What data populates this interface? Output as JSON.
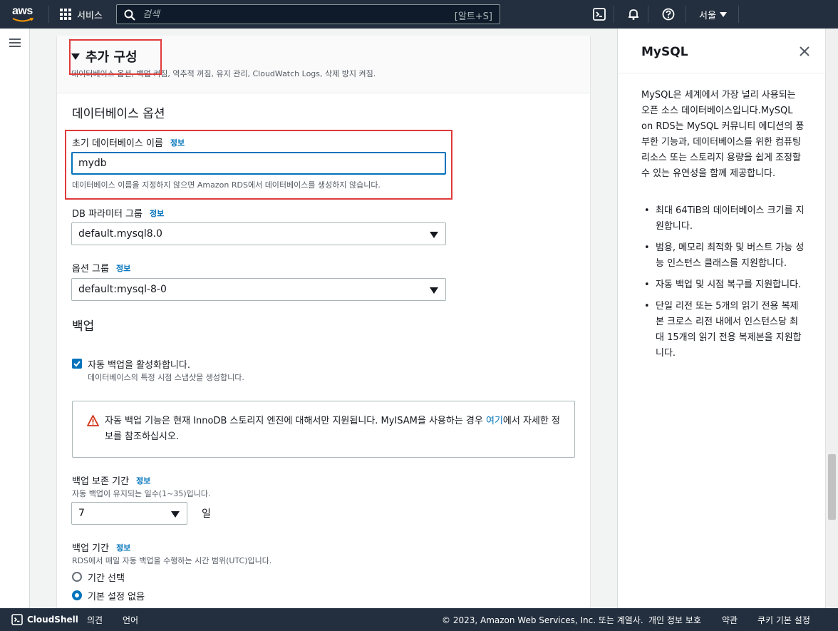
{
  "topnav": {
    "logo": "aws",
    "services_label": "서비스",
    "search_placeholder": "검색",
    "search_shortcut": "[알트+S]",
    "region_label": "서울",
    "icons": [
      "cloudshell-icon",
      "bell-icon",
      "help-icon"
    ]
  },
  "main": {
    "section": {
      "title": "추가 구성",
      "description": "데이터베이스 옵션, 백업 켜짐, 역추적 꺼짐, 유지 관리, CloudWatch Logs, 삭제 방지 켜짐."
    },
    "db_options": {
      "heading": "데이터베이스 옵션",
      "initial_db_name": {
        "label": "초기 데이터베이스 이름",
        "info": "정보",
        "value": "mydb",
        "hint": "데이터베이스 이름을 지정하지 않으면 Amazon RDS에서 데이터베이스를 생성하지 않습니다."
      },
      "db_parameter_group": {
        "label": "DB 파라미터 그룹",
        "info": "정보",
        "value": "default.mysql8.0"
      },
      "option_group": {
        "label": "옵션 그룹",
        "info": "정보",
        "value": "default:mysql-8-0"
      }
    },
    "backup": {
      "heading": "백업",
      "auto_backup": {
        "checked": true,
        "label": "자동 백업을 활성화합니다.",
        "hint": "데이터베이스의 특정 시점 스냅샷을 생성합니다."
      },
      "alert": {
        "text": "자동 백업 기능은 현재 InnoDB 스토리지 엔진에 대해서만 지원됩니다. MyISAM을 사용하는 경우 ",
        "link": "여기",
        "text_after": "에서 자세한 정보를 참조하십시오."
      },
      "retention": {
        "label": "백업 보존 기간",
        "info": "정보",
        "hint": "자동 백업이 유지되는 일수(1~35)입니다.",
        "value": "7",
        "unit": "일"
      },
      "window": {
        "label": "백업 기간",
        "info": "정보",
        "hint": "RDS에서 매일 자동 백업을 수행하는 시간 범위(UTC)입니다.",
        "options": [
          {
            "label": "기간 선택",
            "selected": false
          },
          {
            "label": "기본 설정 없음",
            "selected": true
          }
        ]
      }
    }
  },
  "help_panel": {
    "title": "MySQL",
    "intro": "MySQL은 세계에서 가장 널리 사용되는 오픈 소스 데이터베이스입니다.MySQL on RDS는 MySQL 커뮤니티 에디션의 풍부한 기능과, 데이터베이스를 위한 컴퓨팅 리소스 또는 스토리지 용량을 쉽게 조정할 수 있는 유연성을 함께 제공합니다.",
    "bullets": [
      "최대 64TiB의 데이터베이스 크기를 지원합니다.",
      "범용, 메모리 최적화 및 버스트 가능 성능 인스턴스 클래스를 지원합니다.",
      "자동 백업 및 시점 복구를 지원합니다.",
      "단일 리전 또는 5개의 읽기 전용 복제본 크로스 리전 내에서 인스턴스당 최대 15개의 읽기 전용 복제본을 지원합니다."
    ]
  },
  "footer": {
    "cloudshell": "CloudShell",
    "feedback": "의견",
    "language": "언어",
    "copyright": "© 2023, Amazon Web Services, Inc. 또는 계열사.",
    "privacy": "개인 정보 보호",
    "terms": "약관",
    "cookie": "쿠키 기본 설정"
  },
  "colors": {
    "nav_bg": "#232f3e",
    "link": "#0073bb",
    "highlight_box": "#e03a3a",
    "warning": "#d13212"
  }
}
